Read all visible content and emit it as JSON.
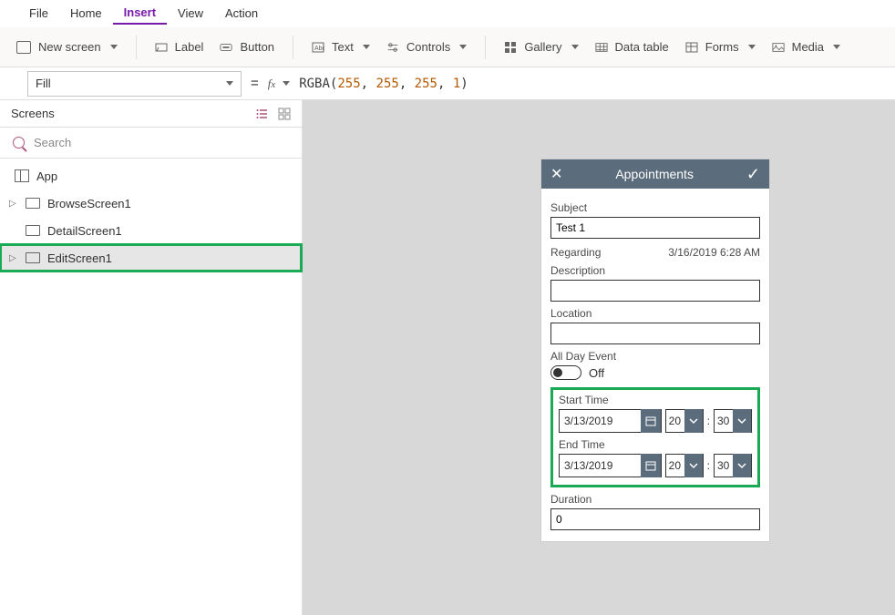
{
  "menu": {
    "file": "File",
    "home": "Home",
    "insert": "Insert",
    "view": "View",
    "action": "Action"
  },
  "ribbon": {
    "new_screen": "New screen",
    "label": "Label",
    "button": "Button",
    "text": "Text",
    "controls": "Controls",
    "gallery": "Gallery",
    "data_table": "Data table",
    "forms": "Forms",
    "media": "Media"
  },
  "formula": {
    "property": "Fill",
    "fn": "RGBA",
    "a0": "255",
    "a1": "255",
    "a2": "255",
    "a3": "1"
  },
  "tree": {
    "title": "Screens",
    "search_ph": "Search",
    "root": "App",
    "items": [
      "BrowseScreen1",
      "DetailScreen1",
      "EditScreen1"
    ]
  },
  "form": {
    "title": "Appointments",
    "subject_lbl": "Subject",
    "subject_val": "Test 1",
    "regarding_lbl": "Regarding",
    "regarding_val": "3/16/2019 6:28 AM",
    "description_lbl": "Description",
    "location_lbl": "Location",
    "allday_lbl": "All Day Event",
    "allday_state": "Off",
    "start_lbl": "Start Time",
    "start_date": "3/13/2019",
    "start_h": "20",
    "start_m": "30",
    "end_lbl": "End Time",
    "end_date": "3/13/2019",
    "end_h": "20",
    "end_m": "30",
    "duration_lbl": "Duration",
    "duration_val": "0"
  }
}
